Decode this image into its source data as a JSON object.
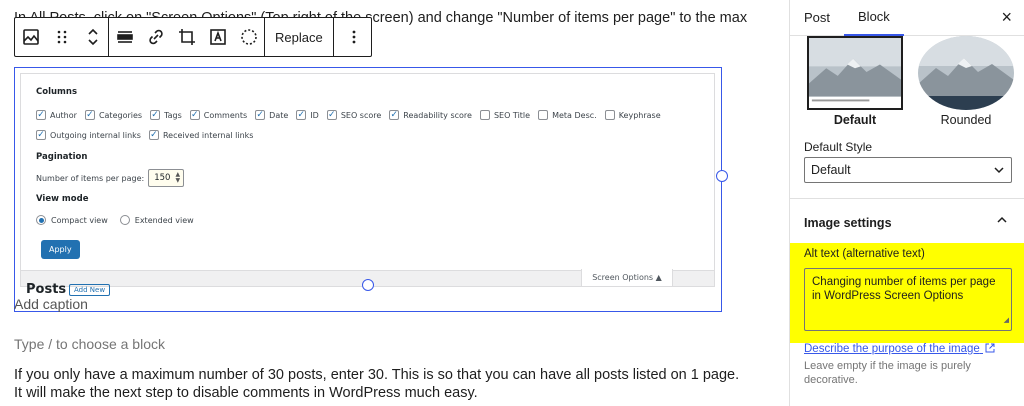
{
  "editor": {
    "intro_text": "In All Posts, click on \"Screen Options\" (Top right of the screen) and change \"Number of items per page\" to the max",
    "toolbar": {
      "replace_label": "Replace",
      "icons": [
        "image-icon",
        "drag-handle-icon",
        "move-up-down-icon",
        "align-icon",
        "link-icon",
        "crop-icon",
        "text-overlay-icon",
        "select-icon",
        "more-options-icon"
      ]
    },
    "caption_placeholder": "Add caption",
    "block_placeholder": "Type / to choose a block",
    "paragraph": "If you only have a maximum number of 30 posts, enter 30. This is so that you can have all posts listed on 1 page. It will make the next step to disable comments in WordPress much easy."
  },
  "screenshot": {
    "columns_heading": "Columns",
    "columns": [
      {
        "label": "Author",
        "checked": true
      },
      {
        "label": "Categories",
        "checked": true
      },
      {
        "label": "Tags",
        "checked": true
      },
      {
        "label": "Comments",
        "checked": true
      },
      {
        "label": "Date",
        "checked": true
      },
      {
        "label": "ID",
        "checked": true
      },
      {
        "label": "SEO score",
        "checked": true
      },
      {
        "label": "Readability score",
        "checked": true
      },
      {
        "label": "SEO Title",
        "checked": false
      },
      {
        "label": "Meta Desc.",
        "checked": false
      },
      {
        "label": "Keyphrase",
        "checked": false
      },
      {
        "label": "Outgoing internal links",
        "checked": true
      },
      {
        "label": "Received internal links",
        "checked": true
      }
    ],
    "pagination_heading": "Pagination",
    "items_per_page_label": "Number of items per page:",
    "items_per_page_value": "150",
    "view_mode_heading": "View mode",
    "view_modes": [
      {
        "label": "Compact view",
        "selected": true
      },
      {
        "label": "Extended view",
        "selected": false
      }
    ],
    "apply_label": "Apply",
    "posts_title": "Posts",
    "add_new_label": "Add New",
    "screen_options_tab": "Screen Options ▲"
  },
  "sidebar": {
    "tabs": [
      "Post",
      "Block"
    ],
    "active_tab": "Block",
    "close_symbol": "×",
    "styles": [
      {
        "label": "Default",
        "active": true
      },
      {
        "label": "Rounded",
        "active": false
      }
    ],
    "default_style_label": "Default Style",
    "default_style_value": "Default",
    "image_settings_title": "Image settings",
    "alt_label": "Alt text (alternative text)",
    "alt_value": "Changing number of items per page in WordPress Screen Options",
    "describe_link": "Describe the purpose of the image",
    "help_text": "Leave empty if the image is purely decorative.",
    "highlight_color": "#ffff00",
    "accent_color": "#3858e9"
  }
}
